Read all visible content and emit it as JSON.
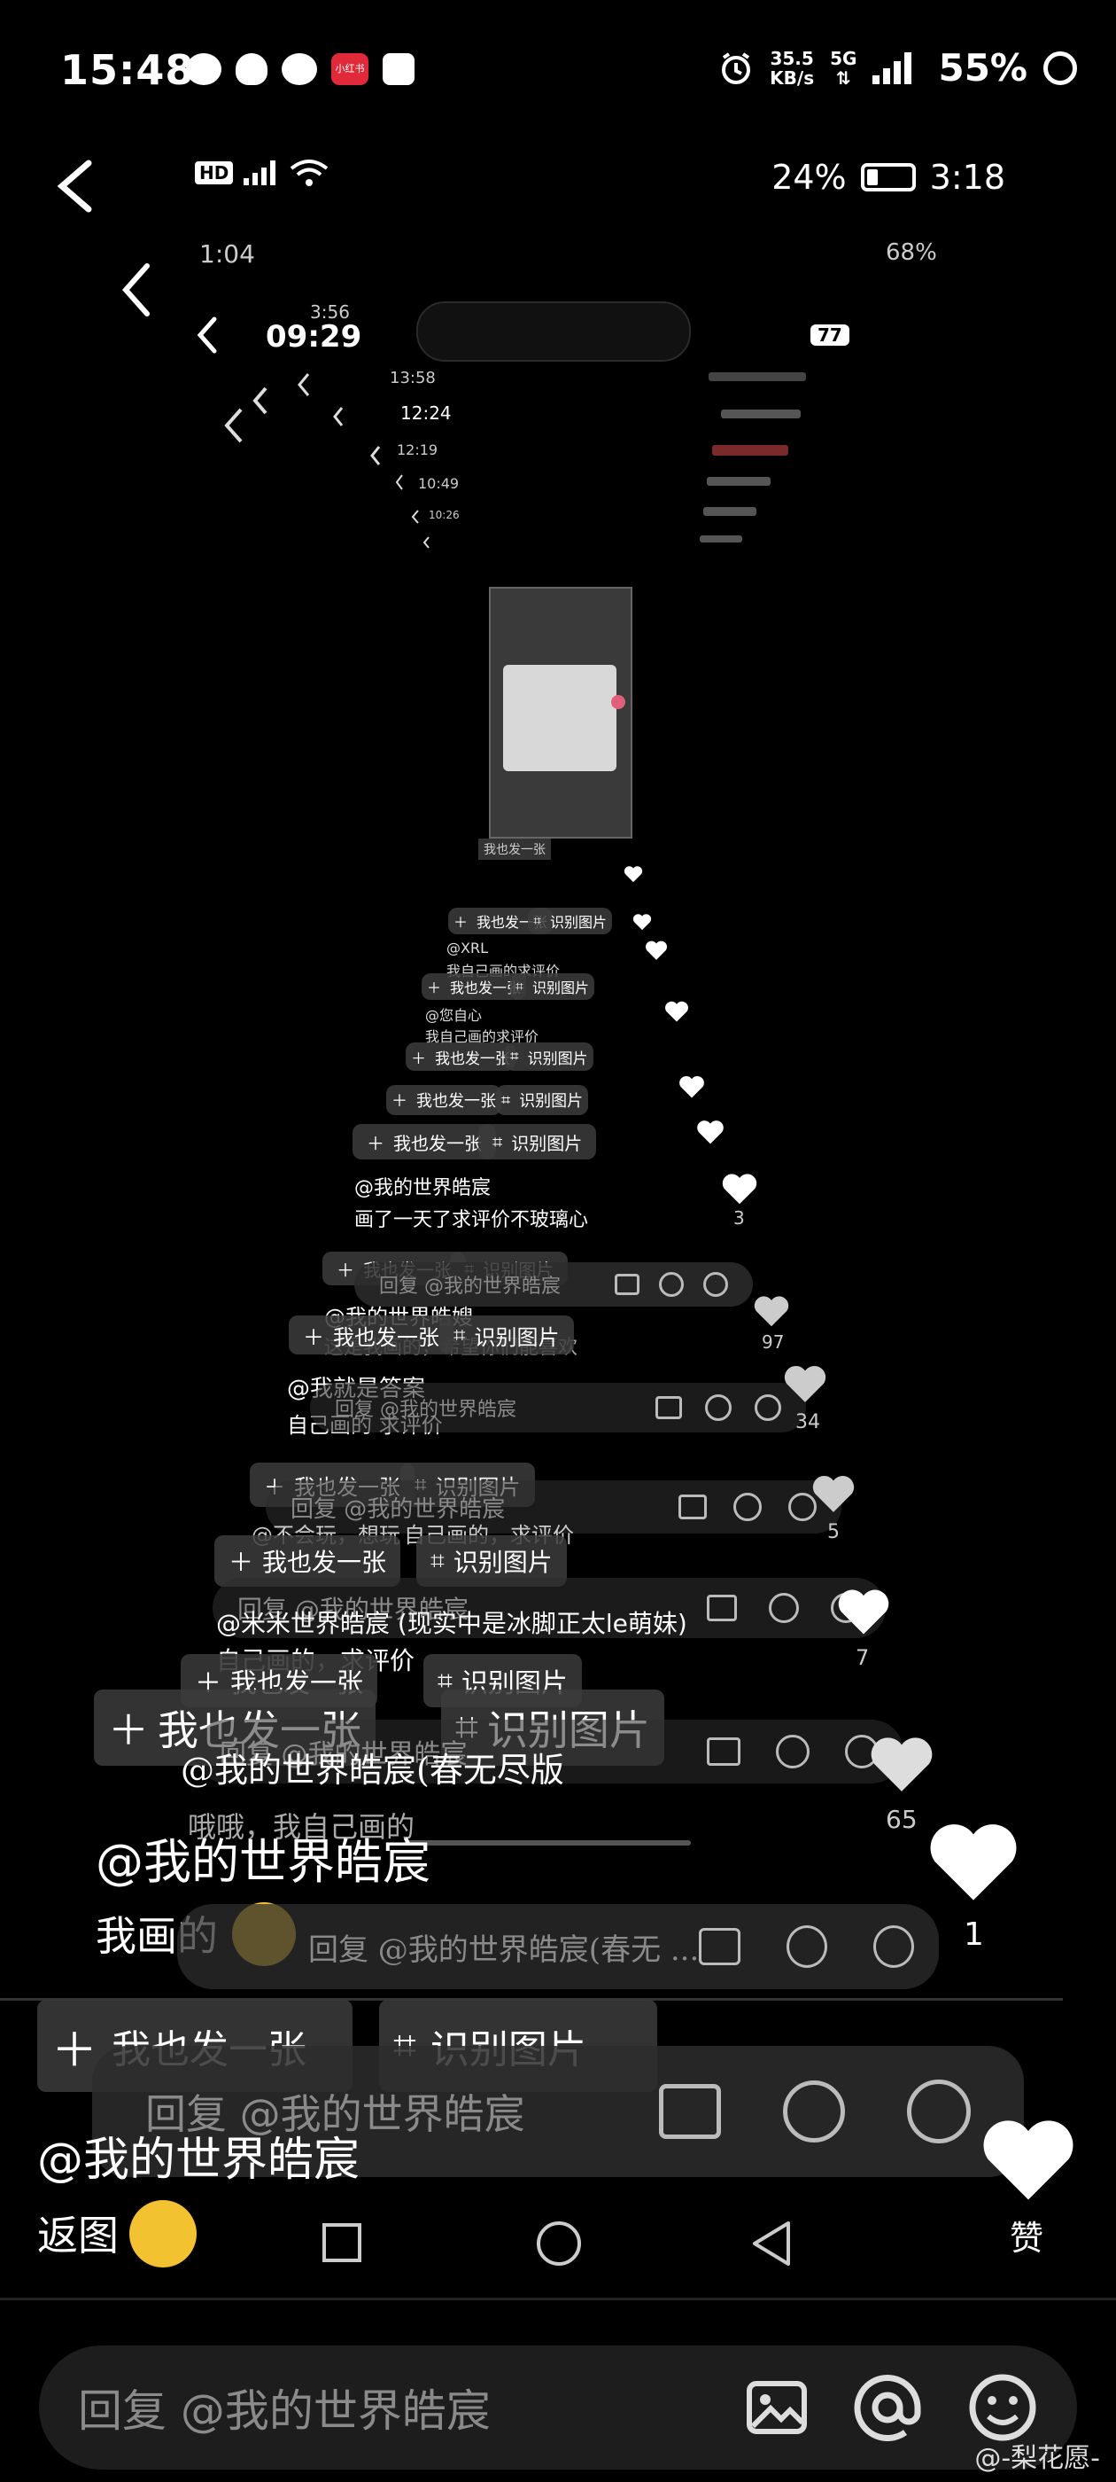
{
  "status_bar": {
    "time": "15:48",
    "net_speed_value": "35.5",
    "net_speed_unit": "KB/s",
    "network": "5G",
    "battery": "55%"
  },
  "inner_status": {
    "hd": "HD",
    "battery": "24%",
    "time": "3:18"
  },
  "nested_labels": {
    "t1": "1:04",
    "t1_battery": "68%",
    "t2": "09:29",
    "t2_badge": "77",
    "t3": "3:56",
    "t4": "13:58",
    "t5": "12:24",
    "t6": "12:19",
    "t7": "10:49",
    "t8": "10:26"
  },
  "post_button": "我也发一张",
  "identify_button": "识别图片",
  "comments": [
    {
      "user": "@我的世界皓宸",
      "text": "画了一天了求评价不玻璃心",
      "likes": "3"
    },
    {
      "user": "@我的世界皓嫂",
      "text": "这是我画的，希望你们能喜欢",
      "likes": "97"
    },
    {
      "user": "@我就是答案",
      "text": "自己画的 求评价",
      "likes": "34"
    },
    {
      "user": "@不会玩，想玩",
      "text": "自己画的，求评价",
      "likes": "5"
    },
    {
      "user": "@米米世界皓宸 (现实中是冰脚正太le萌妹)",
      "text": "自己画的，求评价",
      "likes": "7"
    },
    {
      "user": "@我的世界皓宸(春无尽版",
      "text": "哦哦，我自己画的",
      "likes": "65"
    },
    {
      "user": "@我的世界皓宸",
      "text": "我画的",
      "likes": "1"
    },
    {
      "user": "@我的世界皓宸",
      "text": "返图",
      "likes": "赞"
    }
  ],
  "reply_placeholders": {
    "r1": "回复 @我的世界皓宸",
    "r2": "回复 @我的世界皓宸(春无 ...",
    "r3": "回复 @我的世界皓宸"
  },
  "small_labels": {
    "xrl": "@XRL",
    "xrl_text": "我自己画的求评价",
    "weiyi": "@您自心",
    "weiyi_text": "我自己画的求评价"
  },
  "bottom_reply": {
    "placeholder": "回复 @我的世界皓宸"
  },
  "watermark": "@-梨花愿-",
  "colors": {
    "background": "#000000",
    "chip": "#3c3c3c",
    "reply_bar": "#2d2d2d",
    "text_muted": "#8a8a8a"
  }
}
